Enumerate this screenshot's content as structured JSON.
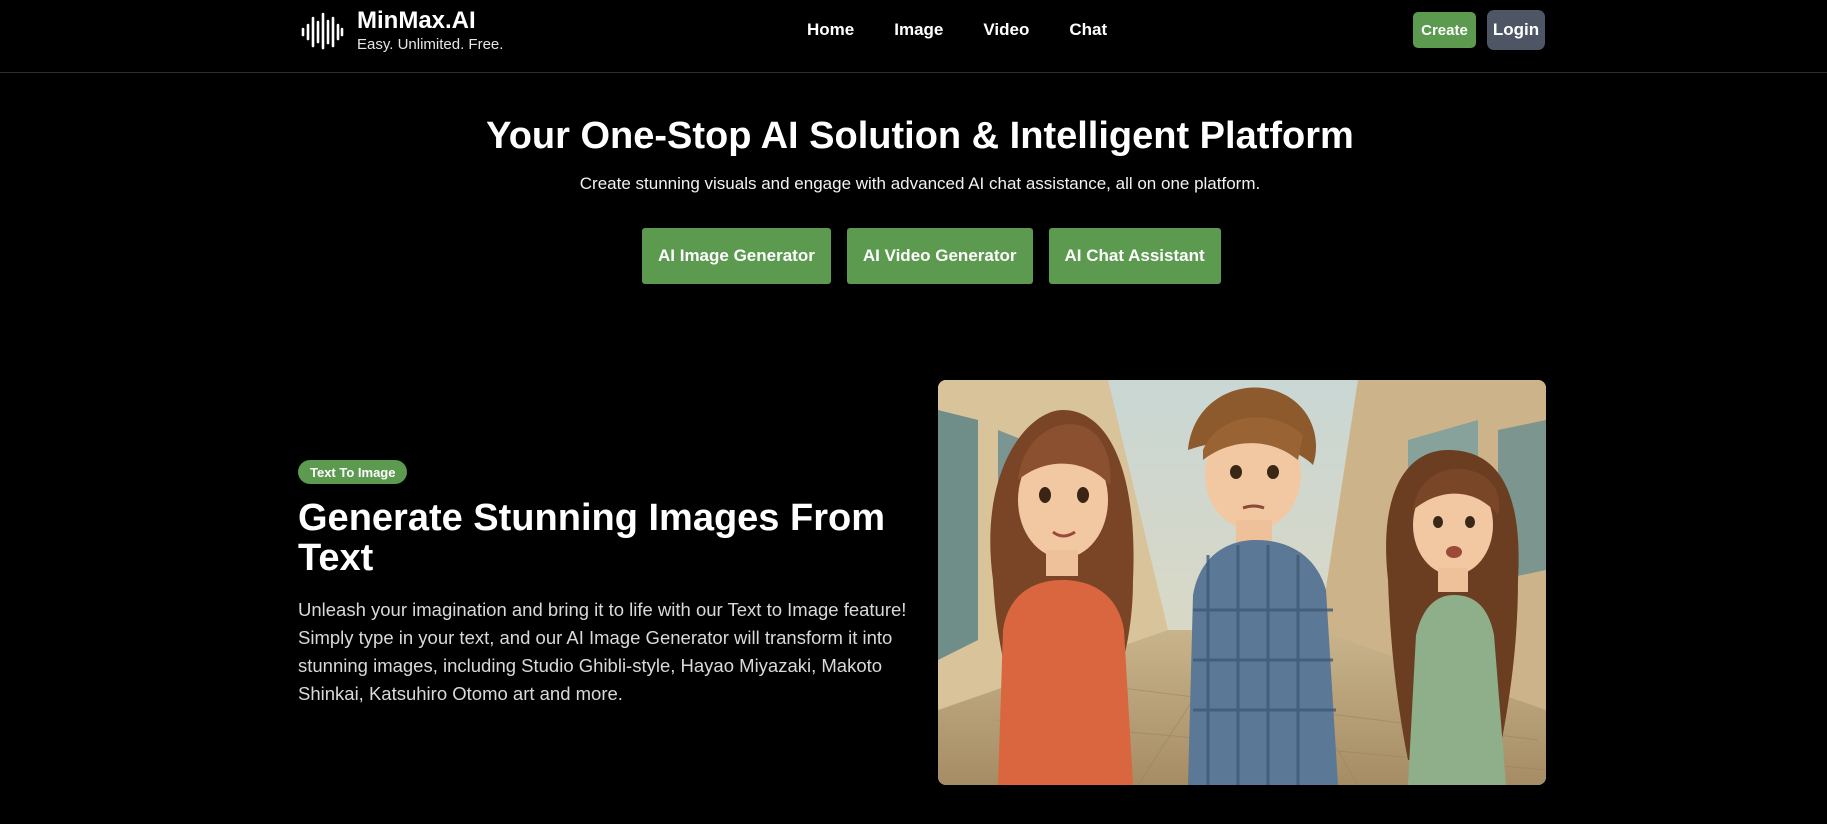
{
  "brand": {
    "name": "MinMax.AI",
    "tagline": "Easy. Unlimited. Free.",
    "logo_icon": "soundwave-icon"
  },
  "nav": {
    "items": [
      {
        "label": "Home"
      },
      {
        "label": "Image"
      },
      {
        "label": "Video"
      },
      {
        "label": "Chat"
      }
    ]
  },
  "header_actions": {
    "create_label": "Create",
    "login_label": "Login"
  },
  "hero": {
    "title": "Your One-Stop AI Solution & Intelligent Platform",
    "subtitle": "Create stunning visuals and engage with advanced AI chat assistance, all on one platform.",
    "buttons": [
      {
        "label": "AI Image Generator"
      },
      {
        "label": "AI Video Generator"
      },
      {
        "label": "AI Chat Assistant"
      }
    ]
  },
  "feature": {
    "badge": "Text To Image",
    "title": "Generate Stunning Images From Text",
    "description": "Unleash your imagination and bring it to life with our Text to Image feature! Simply type in your text, and our AI Image Generator will transform it into stunning images, including Studio Ghibli-style, Hayao Miyazaki, Makoto Shinkai, Katsuhiro Otomo art and more."
  },
  "colors": {
    "accent": "#5c9a4f",
    "login_bg": "#4e5565",
    "background": "#000000"
  }
}
